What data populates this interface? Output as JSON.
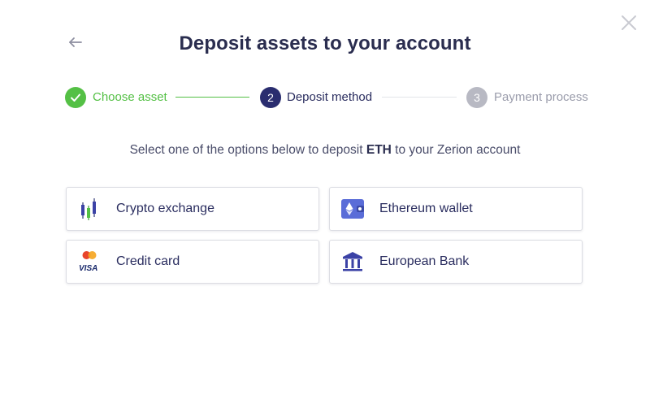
{
  "header": {
    "title": "Deposit assets to your account",
    "back_icon": "arrow-left-icon",
    "close_icon": "close-icon"
  },
  "stepper": {
    "steps": [
      {
        "number": "",
        "label": "Choose asset",
        "state": "completed",
        "color": "#54c045"
      },
      {
        "number": "2",
        "label": "Deposit method",
        "state": "active",
        "color": "#2a2d6f"
      },
      {
        "number": "3",
        "label": "Payment process",
        "state": "pending",
        "color": "#b8b9c3"
      }
    ]
  },
  "instruction": {
    "prefix": "Select one of the options below to deposit ",
    "asset": "ETH",
    "suffix": " to your Zerion account"
  },
  "options": [
    {
      "label": "Crypto exchange",
      "icon": "candlestick-chart-icon"
    },
    {
      "label": "Ethereum wallet",
      "icon": "ethereum-wallet-icon"
    },
    {
      "label": "Credit card",
      "icon": "credit-card-visa-mastercard-icon"
    },
    {
      "label": "European Bank",
      "icon": "bank-icon"
    }
  ],
  "colors": {
    "primary": "#2a2d6f",
    "success": "#54c045",
    "muted": "#b8b9c3",
    "text": "#2a2d4f"
  }
}
